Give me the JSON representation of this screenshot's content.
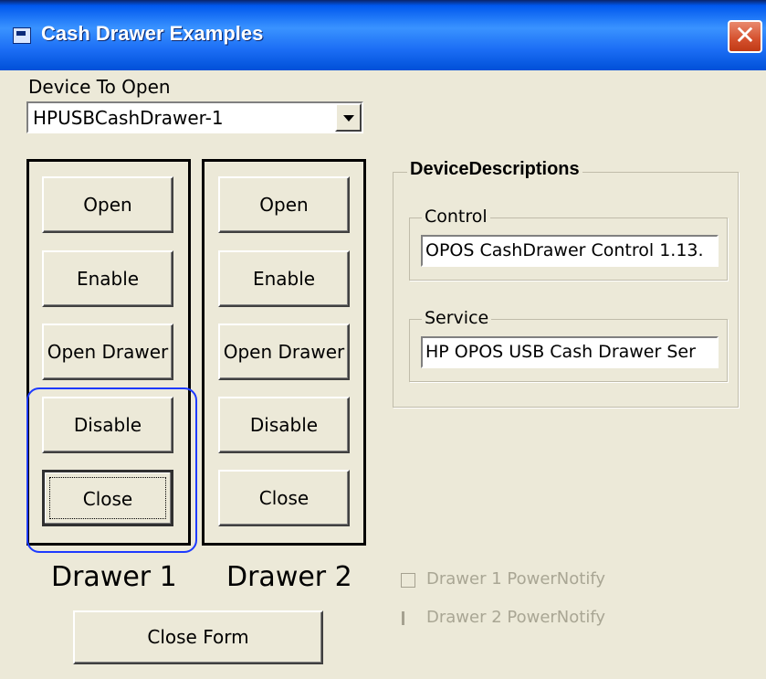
{
  "window": {
    "title": "Cash Drawer Examples",
    "close_glyph": "✕"
  },
  "device": {
    "label": "Device To Open",
    "selected": "HPUSBCashDrawer-1"
  },
  "drawer1": {
    "label": "Drawer 1",
    "buttons": {
      "open": "Open",
      "enable": "Enable",
      "open_drawer": "Open Drawer",
      "disable": "Disable",
      "close": "Close"
    }
  },
  "drawer2": {
    "label": "Drawer 2",
    "buttons": {
      "open": "Open",
      "enable": "Enable",
      "open_drawer": "Open Drawer",
      "disable": "Disable",
      "close": "Close"
    }
  },
  "descriptions": {
    "title": "DeviceDescriptions",
    "control_label": "Control",
    "control_value": "OPOS CashDrawer Control 1.13.",
    "service_label": "Service",
    "service_value": "HP OPOS USB Cash Drawer Ser"
  },
  "power_notify": {
    "drawer1": "Drawer 1 PowerNotify",
    "drawer2": "Drawer 2 PowerNotify"
  },
  "close_form": "Close Form",
  "colors": {
    "titlebar": "#0058ee",
    "face": "#ece9d8",
    "highlight": "#1d3aff",
    "close_button": "#d4502d"
  }
}
